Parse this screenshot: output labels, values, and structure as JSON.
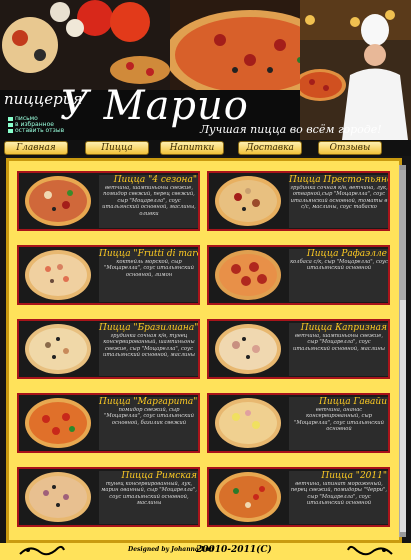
{
  "header": {
    "subtitle": "пиццерия",
    "brand": "У Марио",
    "slogan": "Лучшая пицца во всём городе!",
    "quick_links": [
      "письмо",
      "в избранное",
      "оставить отзыв"
    ]
  },
  "nav": [
    {
      "label": "Главная"
    },
    {
      "label": "Пицца"
    },
    {
      "label": "Напитки"
    },
    {
      "label": "Доставка"
    },
    {
      "label": "Отзывы"
    }
  ],
  "pizzas": [
    {
      "name": "Пицца \"4 сезона\"",
      "desc": "ветчина, шампиньоны свежие, помидор свежий, перец свежий, сыр \"Моцарелла\", соус итальянский основной, маслины, оливки"
    },
    {
      "name": "Пицца Престо-пьяно",
      "desc": "грудинка сочная к/в, ветчина, лук, отварной,сыр \"Моцарелла\", соус итальянский основной, томаты в с/с, маслины, соус табаско"
    },
    {
      "name": "Пицца \"Frutti di mare\"",
      "desc": "коктейль морской, сыр \"Моцарелла\", соус итальянский основной, лимон"
    },
    {
      "name": "Пицца Рафаэлле",
      "desc": "колбаса с/к, сыр \"Моцарелла\", соус итальянский основной"
    },
    {
      "name": "Пицца \"Бразилиана\"",
      "desc": "грудинка сочная к/в, тунец консервированный, шампиньоны свежие, сыр \"Моцарелла\", соус итальянский основной, маслины"
    },
    {
      "name": "Пицца Капризная",
      "desc": "ветчина, шампиньоны свежие, сыр \"Моцарелла\", соус итальянский основной, маслины"
    },
    {
      "name": "Пицца \"Маргарита\"",
      "desc": "помидор свежий, сыр \"Моцарелла\", соус итальянский основной, базилик свежий"
    },
    {
      "name": "Пицца Гавайи",
      "desc": "ветчина, ананас консервированный, сыр \"Моцарелла\", соус итальянский основной"
    },
    {
      "name": "Пицца Римская",
      "desc": "тунец консервированный, лук, марин ованный, сыр \"Моцарелла\", соус итальянский основной, маслины"
    },
    {
      "name": "Пицца \"2011\"",
      "desc": "ветчина, шпинат мороженый, перец свежий, помидоры \"Черри\", сыр \"Моцарелла\", соус итальянский основной"
    }
  ],
  "footer": {
    "credit": "Designed by Johanna Lud",
    "year": "20010-2011(C)"
  },
  "colors": {
    "accent_gold": "#f2c23a",
    "card_border": "#a8141a",
    "pizza_name": "#ffcc22",
    "content_bg": "#ffe25a"
  }
}
